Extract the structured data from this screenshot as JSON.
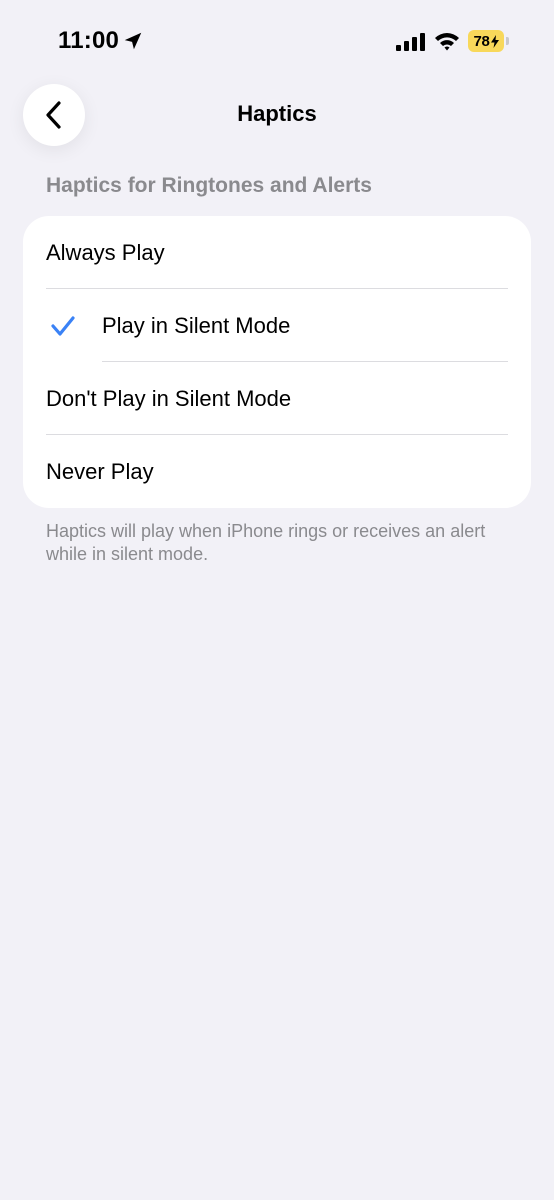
{
  "status_bar": {
    "time": "11:00",
    "battery_level": "78",
    "icons": [
      "location-arrow-icon",
      "cellular-signal-icon",
      "wifi-icon",
      "battery-charging-icon"
    ]
  },
  "nav": {
    "back_icon": "chevron-left-icon",
    "title": "Haptics"
  },
  "section": {
    "header": "Haptics for Ringtones and Alerts",
    "options": [
      {
        "label": "Always Play",
        "selected": false
      },
      {
        "label": "Play in Silent Mode",
        "selected": true
      },
      {
        "label": "Don't Play in Silent Mode",
        "selected": false
      },
      {
        "label": "Never Play",
        "selected": false
      }
    ],
    "footer": "Haptics will play when iPhone rings or receives an alert while in silent mode."
  },
  "colors": {
    "background": "#f2f1f7",
    "accent": "#3a82f6",
    "battery": "#f8d85a",
    "secondary_text": "#8a8a8e"
  }
}
